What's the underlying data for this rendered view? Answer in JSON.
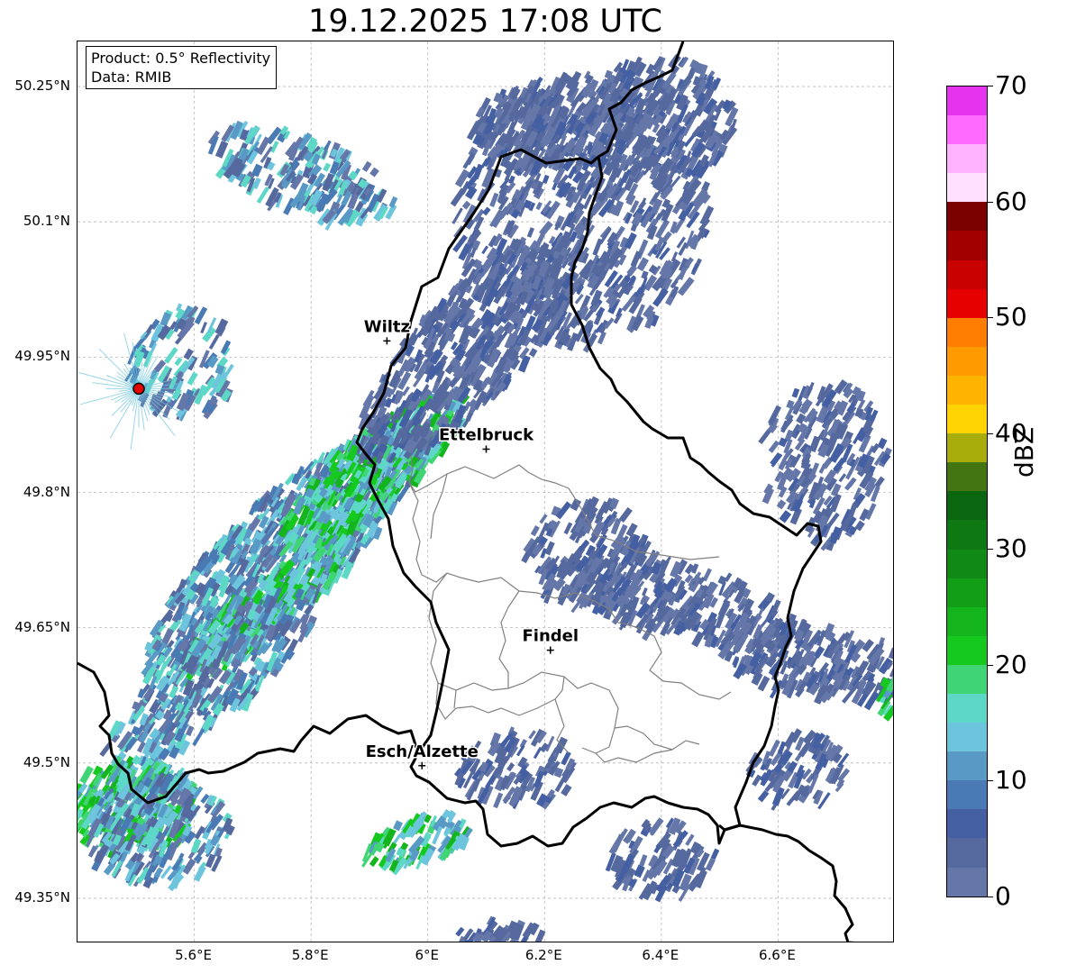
{
  "title": "19.12.2025 17:08 UTC",
  "info": {
    "product": "Product: 0.5° Reflectivity",
    "data": "Data: RMIB"
  },
  "map": {
    "lon_range": [
      5.4,
      6.8
    ],
    "lat_range": [
      49.3,
      50.3
    ],
    "lon_ticks": [
      {
        "value": 5.6,
        "label": "5.6°E"
      },
      {
        "value": 5.8,
        "label": "5.8°E"
      },
      {
        "value": 6.0,
        "label": "6°E"
      },
      {
        "value": 6.2,
        "label": "6.2°E"
      },
      {
        "value": 6.4,
        "label": "6.4°E"
      },
      {
        "value": 6.6,
        "label": "6.6°E"
      }
    ],
    "lat_ticks": [
      {
        "value": 50.25,
        "label": "50.25°N"
      },
      {
        "value": 50.1,
        "label": "50.1°N"
      },
      {
        "value": 49.95,
        "label": "49.95°N"
      },
      {
        "value": 49.8,
        "label": "49.8°N"
      },
      {
        "value": 49.65,
        "label": "49.65°N"
      },
      {
        "value": 49.5,
        "label": "49.5°N"
      },
      {
        "value": 49.35,
        "label": "49.35°N"
      }
    ],
    "cities": [
      {
        "name": "Wiltz",
        "lon": 5.93,
        "lat": 49.968
      },
      {
        "name": "Ettelbruck",
        "lon": 6.1,
        "lat": 49.848
      },
      {
        "name": "Findel",
        "lon": 6.21,
        "lat": 49.625
      },
      {
        "name": "Esch/Alzette",
        "lon": 5.99,
        "lat": 49.497
      }
    ],
    "radar_site": {
      "lon": 5.505,
      "lat": 49.915
    }
  },
  "colorbar": {
    "label": "dBZ",
    "min": 0,
    "max": 70,
    "ticks": [
      "0",
      "10",
      "20",
      "30",
      "40",
      "50",
      "60",
      "70"
    ],
    "colors": [
      "#6577a8",
      "#55699e",
      "#445fa2",
      "#4a7ab4",
      "#5999c6",
      "#6dc5dd",
      "#5ed8c6",
      "#3fd474",
      "#16c91f",
      "#14b51c",
      "#139e17",
      "#108a14",
      "#0e7812",
      "#0b6610",
      "#437612",
      "#a8ad0c",
      "#ffd400",
      "#ffb500",
      "#ff9b00",
      "#ff7d00",
      "#e60000",
      "#c80000",
      "#a20000",
      "#7b0000",
      "#ffe1ff",
      "#ffb3ff",
      "#ff6bff",
      "#e633ee"
    ]
  }
}
